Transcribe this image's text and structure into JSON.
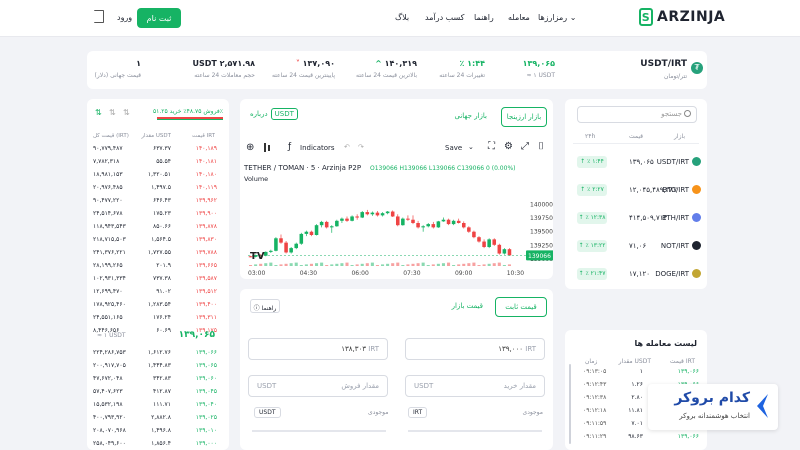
{
  "header": {
    "logo_text": "ARZINJA",
    "nav": [
      "رمزارزها",
      "معامله",
      "راهنما",
      "کسب درآمد",
      "بلاگ"
    ],
    "signup": "ثبت نام",
    "login": "ورود"
  },
  "ticker": {
    "pair": "USDT/IRT",
    "pair_sub": "تتر/تومان",
    "price": "۱۳۹,۰۶۵",
    "price_sub": "≈ ۱ USDT",
    "change": "٪ ۱:۴۴",
    "change_label": "تغییرات 24 ساعته",
    "high": "۱۴۰,۳۱۹",
    "high_label": "بالاترین قیمت 24 ساعته",
    "low": "۱۳۷,۰۹۰",
    "low_label": "پایینترین قیمت 24 ساعته",
    "volume": "USDT ۲,۵۷۱.۹۸",
    "volume_label": "حجم معاملات 24 ساعته",
    "global": "۱",
    "global_label": "قیمت جهانی (دلار)"
  },
  "markets": {
    "search_placeholder": "جستجو",
    "headers": [
      "بازار",
      "قیمت",
      "۲۴h"
    ],
    "rows": [
      {
        "symbol": "USDT/IRT",
        "price": "۱۳۹,۰۶۵",
        "change": "٪ ۱:۴۴",
        "color": "#26a17b"
      },
      {
        "symbol": "BTC/IRT",
        "price": "۱۲,۰۴۵,۴۸۹,۲۸۷",
        "change": "٪ ۲:۲۷",
        "color": "#f7931a"
      },
      {
        "symbol": "ETH/IRT",
        "price": "۴۱۴,۵۰۹,۷۱۳",
        "change": "٪ ۱۲:۳۸",
        "color": "#627eea"
      },
      {
        "symbol": "NOT/IRT",
        "price": "۷۱,۰۶",
        "change": "٪ ۱۳:۲۲",
        "color": "#1f2430"
      },
      {
        "symbol": "DOGE/IRT",
        "price": "۱۷,۱۲۰",
        "change": "٪ ۲۱:۴۷",
        "color": "#c2a633"
      }
    ]
  },
  "trades": {
    "title": "لیست معامله ها",
    "headers": [
      "قیمت IRT",
      "مقدار USDT",
      "زمان"
    ],
    "rows": [
      {
        "price": "۱۳۹,۰۶۶",
        "amount": "۱",
        "time": "۰۹:۱۳:۰۵"
      },
      {
        "price": "۱۳۹,۰۶۶",
        "amount": "۱.۲۶",
        "time": "۰۹:۱۲:۴۳"
      },
      {
        "price": "۱۳۹,۰۶۶",
        "amount": "۲.۸۰",
        "time": "۰۹:۱۲:۳۸"
      },
      {
        "price": "۱۳۹,۰۶۶",
        "amount": "۱۱.۸۱",
        "time": "۰۹:۱۲:۱۸"
      },
      {
        "price": "۱۳۹,۰۶۶",
        "amount": "۷.۰۱",
        "time": "۰۹:۱۱:۵۹"
      },
      {
        "price": "۱۳۹,۰۶۶",
        "amount": "۹۸.۶۳",
        "time": "۰۹:۱۱:۲۹"
      }
    ]
  },
  "chart_card": {
    "tab_arzinja": "بازار ارزینجا",
    "tab_global": "بازار جهانی",
    "about": "درباره",
    "about_badge": "USDT",
    "indicators": "Indicators",
    "save": "Save",
    "legend": "TETHER / TOMAN · 5 · Arzinja P2P",
    "ohlc": "O139066 H139066 L139066 C139066 0 (0.00%)",
    "volume_label": "Volume",
    "price_tag": "139066"
  },
  "chart_data": {
    "type": "candlestick",
    "x": [
      "03:00",
      "04:30",
      "06:00",
      "07:30",
      "09:00",
      "10:30"
    ],
    "ylim": [
      139000,
      140100
    ],
    "yticks": [
      140000,
      139750,
      139500,
      139250,
      139000
    ],
    "candles": [
      [
        139050,
        139060,
        139030,
        139040
      ],
      [
        139040,
        139080,
        139030,
        139070
      ],
      [
        139070,
        139090,
        139050,
        139060
      ],
      [
        139060,
        139140,
        139050,
        139130
      ],
      [
        139130,
        139170,
        139110,
        139150
      ],
      [
        139150,
        139400,
        139140,
        139380
      ],
      [
        139380,
        139450,
        139280,
        139300
      ],
      [
        139300,
        139330,
        139100,
        139120
      ],
      [
        139120,
        139220,
        139100,
        139200
      ],
      [
        139200,
        139300,
        139180,
        139280
      ],
      [
        139280,
        139480,
        139260,
        139460
      ],
      [
        139460,
        139520,
        139420,
        139500
      ],
      [
        139500,
        139520,
        139420,
        139440
      ],
      [
        139440,
        139640,
        139430,
        139620
      ],
      [
        139620,
        139700,
        139580,
        139680
      ],
      [
        139680,
        139700,
        139560,
        139580
      ],
      [
        139580,
        139620,
        139480,
        139600
      ],
      [
        139600,
        139720,
        139590,
        139700
      ],
      [
        139700,
        139760,
        139660,
        139740
      ],
      [
        139740,
        139780,
        139680,
        139700
      ],
      [
        139700,
        139800,
        139690,
        139780
      ],
      [
        139780,
        139820,
        139720,
        139760
      ],
      [
        139760,
        139880,
        139750,
        139860
      ],
      [
        139860,
        139900,
        139800,
        139820
      ],
      [
        139820,
        139870,
        139790,
        139850
      ],
      [
        139850,
        139880,
        139780,
        139800
      ],
      [
        139800,
        139860,
        139780,
        139840
      ],
      [
        139840,
        139880,
        139820,
        139870
      ],
      [
        139870,
        139890,
        139770,
        139780
      ],
      [
        139780,
        139820,
        139600,
        139620
      ],
      [
        139620,
        139760,
        139610,
        139740
      ],
      [
        139740,
        139800,
        139700,
        139720
      ],
      [
        139720,
        139800,
        139640,
        139660
      ],
      [
        139660,
        139700,
        139560,
        139580
      ],
      [
        139580,
        139620,
        139500,
        139600
      ],
      [
        139600,
        139660,
        139580,
        139640
      ],
      [
        139640,
        139680,
        139560,
        139580
      ],
      [
        139580,
        139700,
        139570,
        139690
      ],
      [
        139690,
        139760,
        139680,
        139720
      ],
      [
        139720,
        139740,
        139620,
        139640
      ],
      [
        139640,
        139720,
        139620,
        139700
      ],
      [
        139700,
        139740,
        139650,
        139660
      ],
      [
        139660,
        139690,
        139560,
        139580
      ],
      [
        139580,
        139600,
        139480,
        139500
      ],
      [
        139500,
        139520,
        139380,
        139400
      ],
      [
        139400,
        139420,
        139300,
        139320
      ],
      [
        139320,
        139360,
        139200,
        139220
      ],
      [
        139220,
        139380,
        139200,
        139360
      ],
      [
        139360,
        139380,
        139240,
        139260
      ],
      [
        139260,
        139280,
        139080,
        139100
      ],
      [
        139100,
        139200,
        139080,
        139180
      ],
      [
        139180,
        139200,
        139060,
        139066
      ]
    ]
  },
  "order_form": {
    "tab_fixed": "قیمت ثابت",
    "tab_market": "قیمت بازار",
    "guide": "راهنما",
    "buy_price_value": "۱۳۹,۰۰۰",
    "buy_price_unit": "IRT",
    "sell_price_value": "۱۳۸,۳۰۳",
    "sell_price_unit": "IRT",
    "buy_amount_placeholder": "مقدار خرید",
    "sell_amount_placeholder": "مقدار فروش",
    "unit_usdt": "USDT",
    "balance_label": "موجودی",
    "buy_currency": "IRT",
    "sell_currency": "USDT"
  },
  "order_book": {
    "summary": "فروش ۴۸.۷۵٪ خرید ۵۱.۲۵٪",
    "headers": [
      "قیمت IRT",
      "مقدار USDT",
      "قیمت کل (IRT)"
    ],
    "asks": [
      [
        "۱۴۰,۱۸۹",
        "۶۳۷.۳۷",
        "۹۰,۷۷۹,۴۸۷"
      ],
      [
        "۱۴۰,۱۸۱",
        "۵۵.۵۴",
        "۷,۷۸۲,۳۱۸"
      ],
      [
        "۱۴۰,۱۸۰",
        "۱,۳۲۰.۵۱",
        "۱۸,۹۸۱,۱۵۳"
      ],
      [
        "۱۴۰,۱۱۹",
        "۱,۴۹۷.۵",
        "۲۰,۹۷۶,۴۸۵"
      ],
      [
        "۱۳۹,۹۶۲",
        "۶۴۶.۴۳",
        "۹۰,۴۷۷,۲۲۰"
      ],
      [
        "۱۳۹,۹۰۰",
        "۱۷۵.۲۳",
        "۲۴,۵۱۴,۶۷۸"
      ],
      [
        "۱۳۹,۸۷۸",
        "۸۵۰.۶۶",
        "۱۱۸,۹۴۳,۵۴۳"
      ],
      [
        "۱۳۹,۸۳۰",
        "۱,۵۶۴.۵",
        "۲۱۸,۷۱۵,۵۰۳"
      ],
      [
        "۱۳۹,۷۸۸",
        "۱,۷۲۷.۵۵",
        "۲۴۱,۳۷۶,۲۲۱"
      ],
      [
        "۱۳۹,۶۶۵",
        "۲۰۱.۹",
        "۲۸,۱۹۹,۲۶۵"
      ],
      [
        "۱۳۹,۵۸۷",
        "۷۳۷.۳۸",
        "۱۰۲,۹۳۱,۳۳۴"
      ],
      [
        "۱۳۹,۵۱۲",
        "۹۱.۰۲",
        "۱۲,۶۹۹,۴۷۰"
      ],
      [
        "۱۳۹,۴۰۰",
        "۱,۲۸۳.۵۴",
        "۱۷۸,۹۲۵,۴۶۰"
      ],
      [
        "۱۳۹,۳۱۱",
        "۱۷۶.۲۴",
        "۲۴,۵۵۱,۱۶۵"
      ],
      [
        "۱۳۹,۱۷۵",
        "۶۰.۶۹",
        "۸,۴۴۶,۶۵۶"
      ]
    ],
    "last_price": "۱۳۹,۰۶۵",
    "last_price_sub": "≈ ۱ USDT",
    "bids": [
      [
        "۱۳۹,۰۶۶",
        "۱,۶۱۲.۷۶",
        "۲۲۴,۲۸۶,۷۵۳"
      ],
      [
        "۱۳۹,۰۶۵",
        "۱,۴۴۴.۸۳",
        "۲۰۰,۹۱۷,۷۰۵"
      ],
      [
        "۱۳۹,۰۶۰",
        "۳۴۲.۸۳",
        "۴۷,۶۷۲,۰۴۸"
      ],
      [
        "۱۳۹,۰۴۵",
        "۴۱۲.۸۷",
        "۵۷,۴۰۷,۶۲۳"
      ],
      [
        "۱۳۹,۰۴۰",
        "۱۱۱.۷۱",
        "۱۵,۵۳۲,۱۹۸"
      ],
      [
        "۱۳۹,۰۲۵",
        "۲,۸۸۲.۸",
        "۴۰۰,۷۹۳,۹۲۰"
      ],
      [
        "۱۳۹,۰۱۰",
        "۱,۴۹۶.۸",
        "۲۰۸,۰۷۰,۹۶۸"
      ],
      [
        "۱۳۹,۰۰۰",
        "۱,۸۵۶.۴",
        "۲۵۸,۰۴۹,۶۰۰"
      ]
    ]
  },
  "watermark": {
    "title": "کدام بروکر",
    "subtitle": "انتخاب هوشمندانه بروکر"
  }
}
